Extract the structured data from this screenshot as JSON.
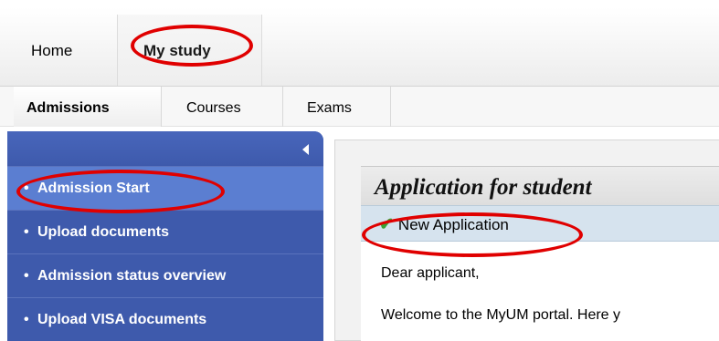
{
  "top_nav": {
    "tabs": [
      {
        "label": "Home"
      },
      {
        "label": "My study"
      }
    ]
  },
  "sub_nav": {
    "tabs": [
      {
        "label": "Admissions"
      },
      {
        "label": "Courses"
      },
      {
        "label": "Exams"
      }
    ]
  },
  "sidebar": {
    "collapse_icon": "collapse-left-icon",
    "items": [
      {
        "bullet": "•",
        "label": "Admission Start",
        "active": true
      },
      {
        "bullet": "•",
        "label": "Upload documents"
      },
      {
        "bullet": "•",
        "label": "Admission status overview"
      },
      {
        "bullet": "•",
        "label": "Upload VISA documents"
      }
    ]
  },
  "main": {
    "title": "Application for student",
    "toolbar": {
      "check_icon": "✔",
      "new_application_label": "New Application"
    },
    "greeting": "Dear applicant,",
    "welcome_text": "Welcome to the MyUM portal. Here y"
  },
  "colors": {
    "sidebar_bg": "#3e5aac",
    "sidebar_active": "#5b7ed1",
    "highlight": "#e00000",
    "check": "#3aa335"
  }
}
